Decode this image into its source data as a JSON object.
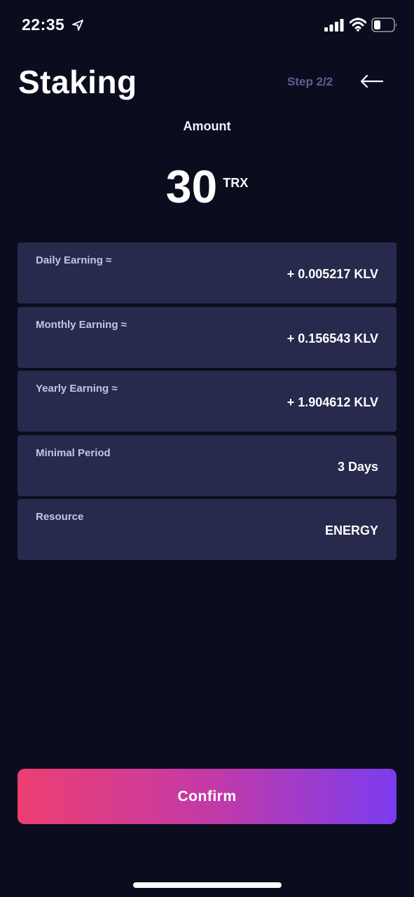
{
  "status_bar": {
    "time": "22:35",
    "icons": [
      "location-arrow-icon",
      "cellular-signal-icon",
      "wifi-icon",
      "battery-icon"
    ]
  },
  "header": {
    "title": "Staking",
    "step": "Step 2/2",
    "back_icon": "arrow-left-icon"
  },
  "amount": {
    "label": "Amount",
    "value": "30",
    "unit": "TRX"
  },
  "details": [
    {
      "label": "Daily Earning ≈",
      "value": "+ 0.005217 KLV"
    },
    {
      "label": "Monthly Earning ≈",
      "value": "+ 0.156543 KLV"
    },
    {
      "label": "Yearly Earning ≈",
      "value": "+ 1.904612 KLV"
    },
    {
      "label": "Minimal Period",
      "value": "3 Days"
    },
    {
      "label": "Resource",
      "value": "ENERGY"
    }
  ],
  "confirm_label": "Confirm",
  "colors": {
    "background": "#0b0c1e",
    "card": "#272a4d",
    "step_text": "#5e5f94",
    "gradient_start": "#ec3f72",
    "gradient_end": "#7b3cee"
  }
}
